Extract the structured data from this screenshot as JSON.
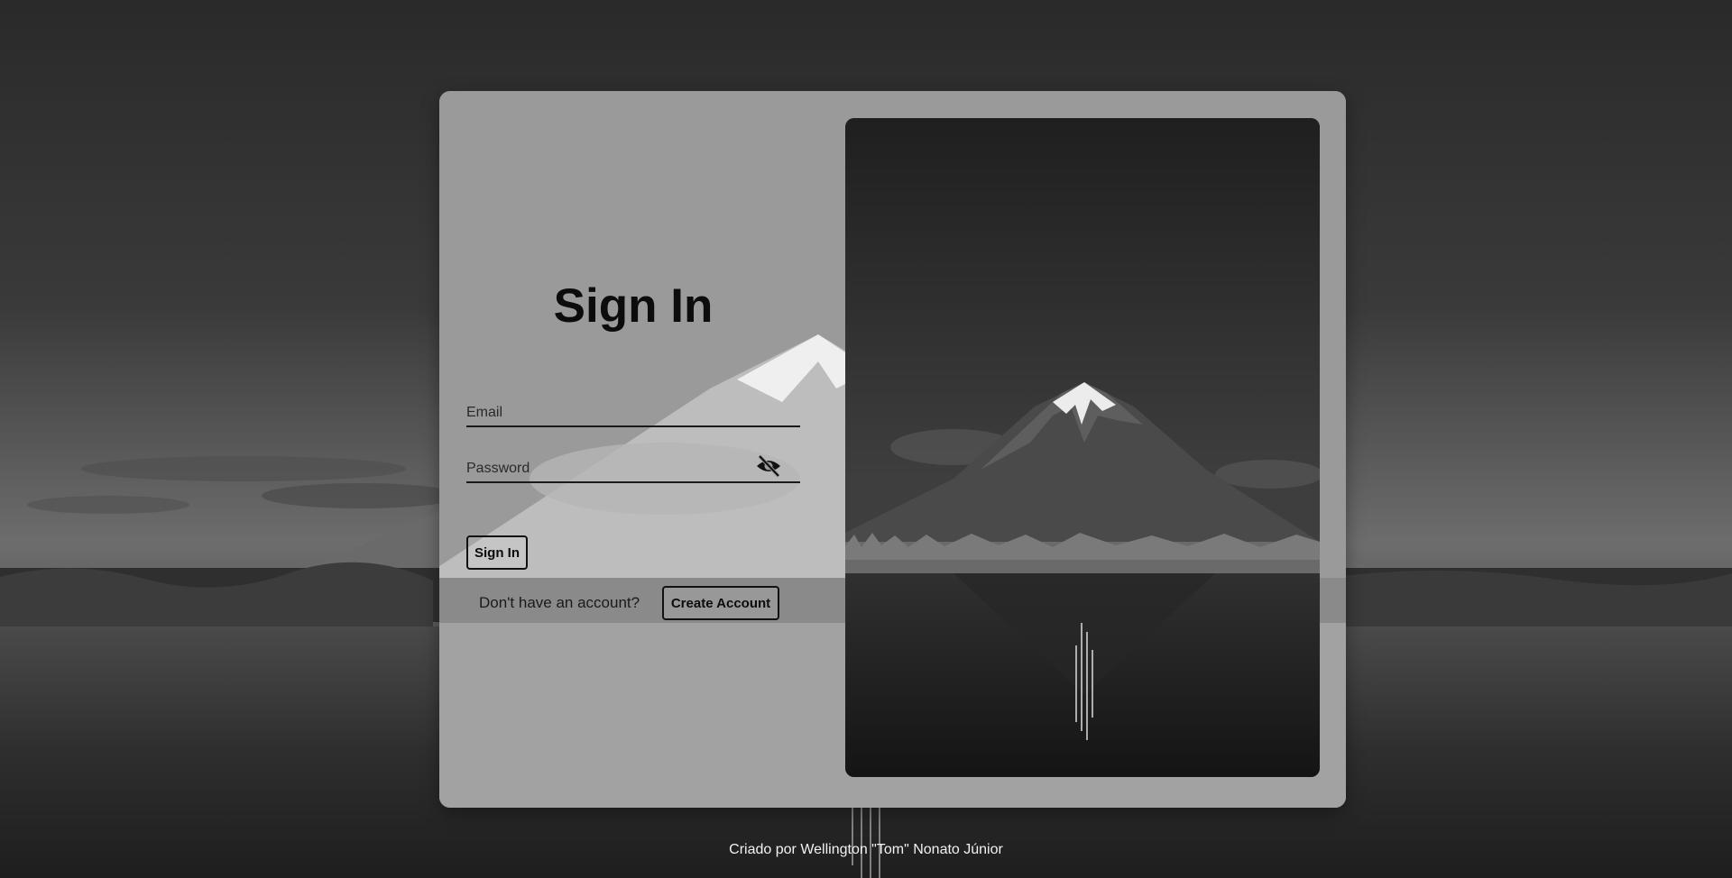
{
  "login": {
    "title": "Sign In",
    "email_placeholder": "Email",
    "password_placeholder": "Password",
    "signin_label": "Sign In",
    "no_account_text": "Don't have an account?",
    "create_account_label": "Create Account",
    "password_visibility_icon": "eye-off-icon"
  },
  "footer": {
    "credit": "Criado por Wellington \"Tom\" Nonato Júnior"
  },
  "colors": {
    "card_overlay": "#c8c8c8",
    "text": "#0c0c0c",
    "footer_text": "#f2f2f2"
  }
}
